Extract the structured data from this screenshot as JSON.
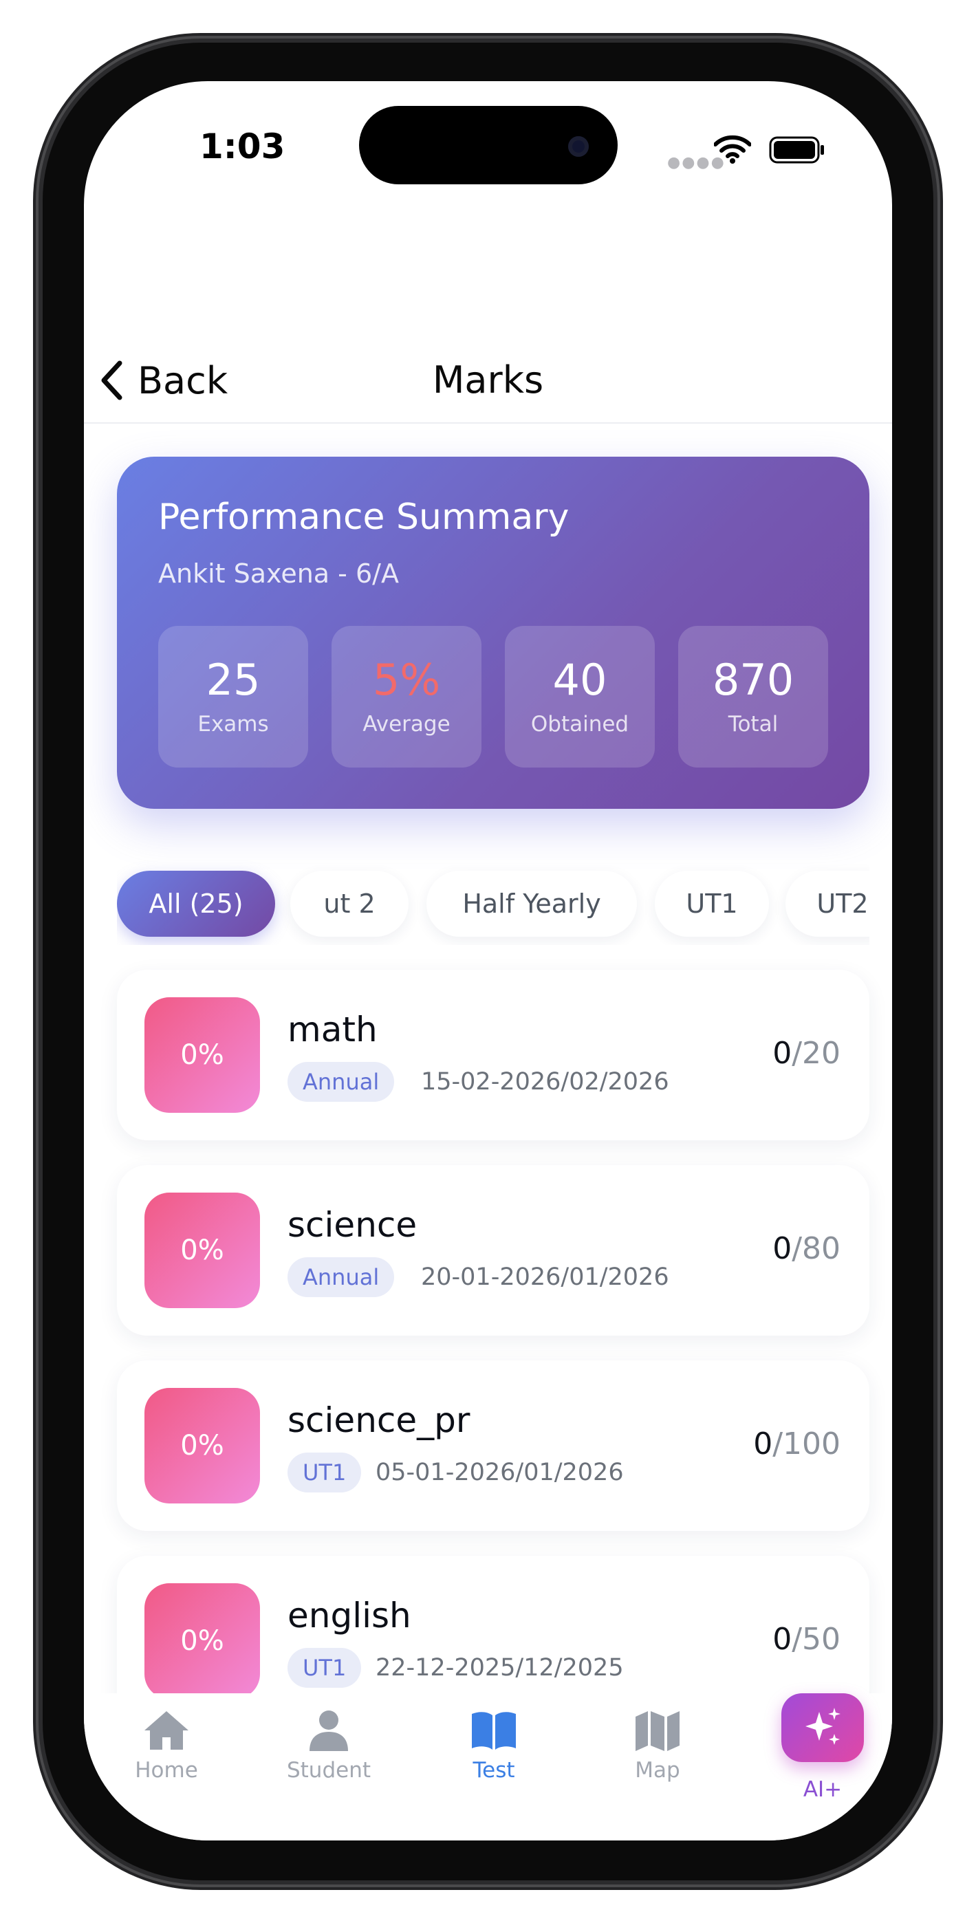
{
  "status_bar": {
    "time": "1:03"
  },
  "header": {
    "back_label": "Back",
    "title": "Marks"
  },
  "summary": {
    "title": "Performance Summary",
    "student": "Ankit Saxena - 6/A",
    "stats": [
      {
        "value": "25",
        "label": "Exams",
        "color": "#ffffff"
      },
      {
        "value": "5%",
        "label": "Average",
        "color": "#f26a6a"
      },
      {
        "value": "40",
        "label": "Obtained",
        "color": "#ffffff"
      },
      {
        "value": "870",
        "label": "Total",
        "color": "#ffffff"
      }
    ]
  },
  "filters": [
    {
      "label": "All (25)",
      "active": true
    },
    {
      "label": "ut 2",
      "active": false
    },
    {
      "label": "Half Yearly",
      "active": false
    },
    {
      "label": "UT1",
      "active": false
    },
    {
      "label": "UT2",
      "active": false
    }
  ],
  "marks": [
    {
      "percent": "0%",
      "subject": "math",
      "exam": "Annual",
      "date": "15-02-2026/02/2026",
      "obtained": "0",
      "total": "/20"
    },
    {
      "percent": "0%",
      "subject": "science",
      "exam": "Annual",
      "date": "20-01-2026/01/2026",
      "obtained": "0",
      "total": "/80"
    },
    {
      "percent": "0%",
      "subject": "science_pr",
      "exam": "UT1",
      "date": "05-01-2026/01/2026",
      "obtained": "0",
      "total": "/100"
    },
    {
      "percent": "0%",
      "subject": "english",
      "exam": "UT1",
      "date": "22-12-2025/12/2025",
      "obtained": "0",
      "total": "/50"
    }
  ],
  "nav": {
    "home": "Home",
    "student": "Student",
    "test": "Test",
    "map": "Map",
    "ai": "AI+",
    "active": "test"
  },
  "colors": {
    "accent": "#3b7fe4",
    "summary_gradient_start": "#6a7fe3",
    "summary_gradient_end": "#7449a4",
    "percent_gradient_start": "#f15a86",
    "percent_gradient_end": "#f28ad8",
    "tag_text": "#6272d6"
  }
}
